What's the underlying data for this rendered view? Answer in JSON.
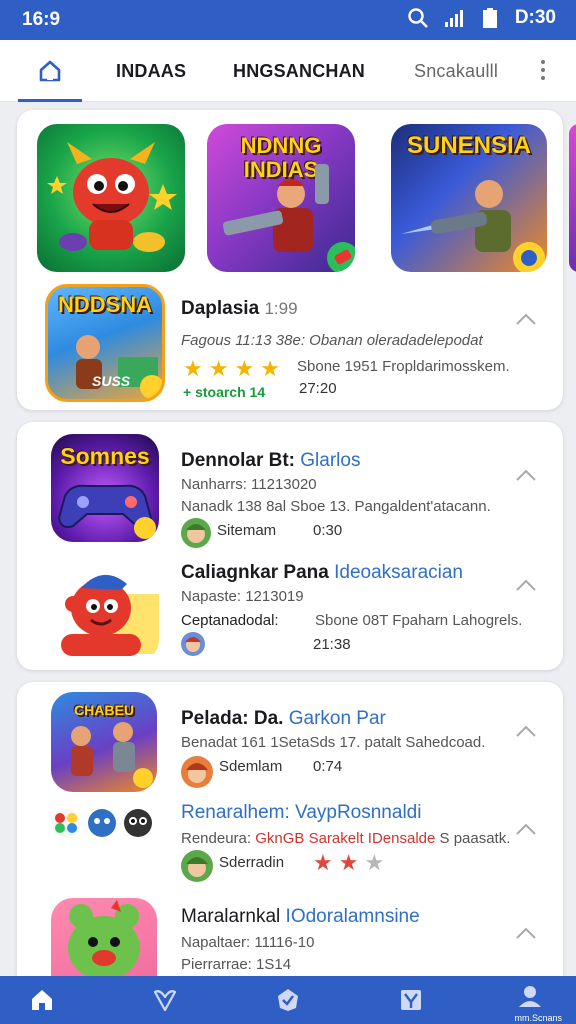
{
  "status": {
    "time": "16:9",
    "clock": "D:30"
  },
  "tabs": {
    "t1": "INDAAS",
    "t2": "HNGSANCHAN",
    "t3": "Sncakaulll"
  },
  "banners": {
    "b1": "",
    "b2": "NDNNG\nINDIAS",
    "b3": "SUNENSIA"
  },
  "card1": {
    "icon_title": "NDDSNA",
    "icon_badge": "SUSS",
    "name": "Daplasia",
    "name_suffix": "1:99",
    "line1": "Fagous 11:13 38e: Obanan oleradadelepodat",
    "line2": "Sbone 1951 Fropldarimosskem.",
    "tag": "+ stoarch 14",
    "time": "27:20"
  },
  "card2": {
    "app1": {
      "icon_title": "Somnes",
      "name": "Dennolar Bt:",
      "dev": "Glarlos",
      "line1": "Nanharrs: 11213020",
      "line2": "Nanadk 138 8al Sboe 13. Pangaldent'atacann.",
      "avatar_text": "Sitemam",
      "time": "0:30"
    },
    "app2": {
      "name": "Caliagnkar Pana",
      "dev": "Ideoaksaracian",
      "line1": "Napaste: 1213019",
      "line2a": "Ceptanadodal:",
      "line2b": "Sbone 08T Fpaharn Lahogrels.",
      "time": "21:38"
    }
  },
  "card3": {
    "app1": {
      "icon_title": "CHABEU",
      "name": "Pelada: Da.",
      "dev": "Garkon Par",
      "line1": "Benadat 161 1SetaSds 17. patalt Sahedcoad.",
      "avatar_text": "Sdemlam",
      "time": "0:74"
    },
    "app2": {
      "name": "Renaralhem: VaypRosnnaldi",
      "line_a": "Rendeura:",
      "line_b": "GknGB Sarakelt",
      "line_c": "IDensalde",
      "line_d": "S paasatk.",
      "avatar_text": "Sderradin"
    },
    "app3": {
      "name": "Maralarnkal",
      "dev": "IOdoralamnsine",
      "line1": "Napaltaer: 11116-10",
      "line2": "Pierrarrae: 1S14"
    }
  },
  "bottomnav": {
    "profile_label": "mm.Scnans"
  },
  "colors": {
    "primary": "#2f5fc4",
    "accent_blue": "#2f6fc4",
    "star": "#f4b400",
    "red": "#d0342c"
  }
}
